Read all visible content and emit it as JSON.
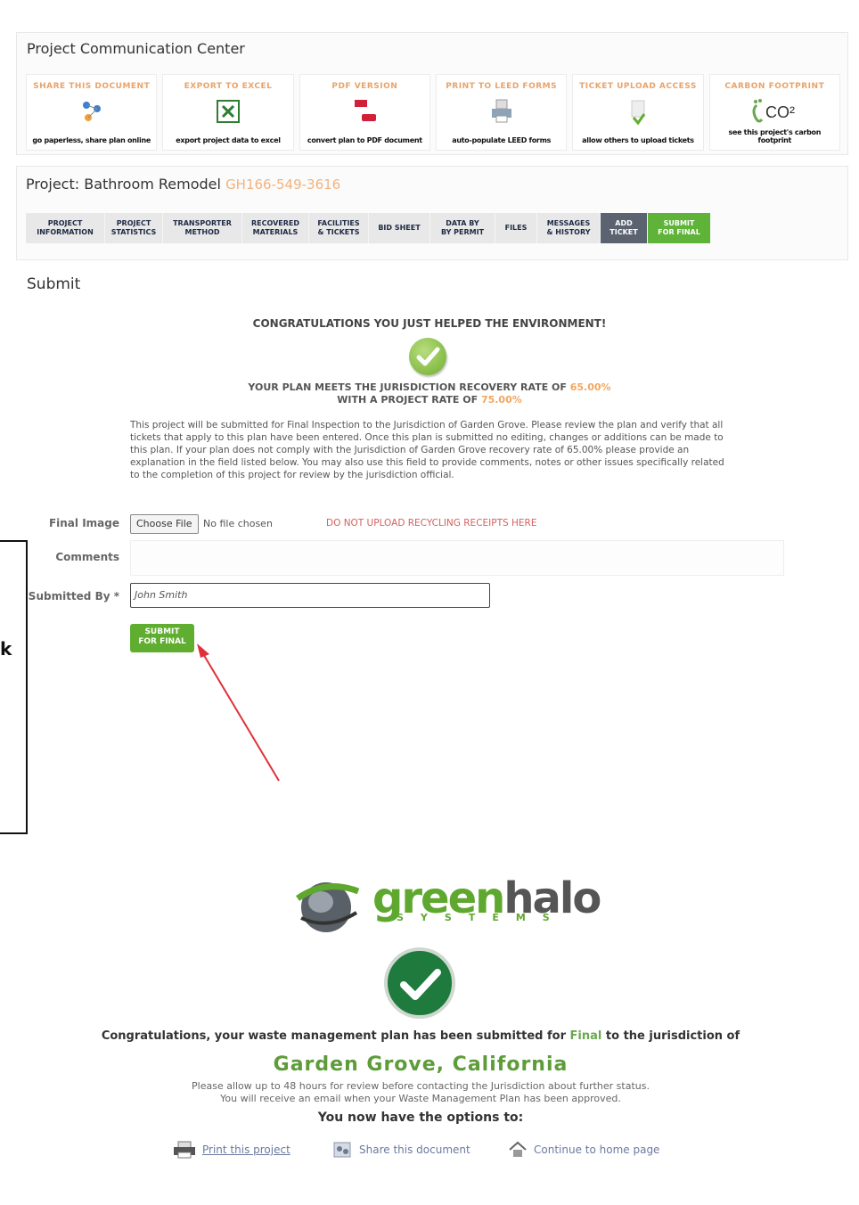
{
  "center": {
    "title": "Project Communication Center",
    "tools": [
      {
        "title": "SHARE THIS DOCUMENT",
        "desc": "go paperless, share plan online",
        "icon": "share-icon"
      },
      {
        "title": "EXPORT TO EXCEL",
        "desc": "export project data to excel",
        "icon": "excel-icon"
      },
      {
        "title": "PDF VERSION",
        "desc": "convert plan to PDF document",
        "icon": "pdf-icon"
      },
      {
        "title": "PRINT TO LEED FORMS",
        "desc": "auto-populate LEED forms",
        "icon": "print-icon"
      },
      {
        "title": "TICKET UPLOAD ACCESS",
        "desc": "allow others to upload tickets",
        "icon": "upload-icon"
      },
      {
        "title": "CARBON FOOTPRINT",
        "desc": "see this project's carbon footprint",
        "icon": "co2-icon"
      }
    ]
  },
  "project": {
    "label": "Project:",
    "name": "Bathroom Remodel",
    "id": "GH166-549-3616",
    "tabs": [
      {
        "line1": "PROJECT",
        "line2": "INFORMATION"
      },
      {
        "line1": "PROJECT",
        "line2": "STATISTICS"
      },
      {
        "line1": "TRANSPORTER",
        "line2": "METHOD"
      },
      {
        "line1": "RECOVERED",
        "line2": "MATERIALS"
      },
      {
        "line1": "FACILITIES",
        "line2": "& TICKETS"
      },
      {
        "line1": "BID SHEET",
        "line2": ""
      },
      {
        "line1": "DATA BY",
        "line2": "BY PERMIT"
      },
      {
        "line1": "FILES",
        "line2": ""
      },
      {
        "line1": "MESSAGES",
        "line2": "& HISTORY"
      },
      {
        "line1": "ADD",
        "line2": "TICKET"
      },
      {
        "line1": "SUBMIT",
        "line2": "FOR FINAL"
      }
    ]
  },
  "submit": {
    "heading": "Submit",
    "congrats": "CONGRATULATIONS YOU JUST HELPED THE ENVIRONMENT!",
    "rate_prefix": "YOUR PLAN MEETS THE JURISDICTION RECOVERY RATE OF",
    "rate_jurisdiction": "65.00%",
    "rate_mid": "WITH A PROJECT RATE OF",
    "rate_project": "75.00%",
    "body": "This project will be submitted for Final Inspection to the Jurisdiction of Garden Grove. Please review the plan and verify that all tickets that apply to this plan have been entered. Once this plan is submitted no editing, changes or additions can be made to this plan. If your plan does not comply with the Jurisdiction of Garden Grove recovery rate of 65.00% please provide an explanation in the field listed below. You may also use this field to provide comments, notes or other issues specifically related to the completion of this project for review by the jurisdiction official.",
    "final_image_label": "Final Image",
    "choose_file": "Choose File",
    "no_file": "No file chosen",
    "warning": "DO NOT UPLOAD RECYCLING RECEIPTS HERE",
    "comments_label": "Comments",
    "submitted_by_label": "Submitted By *",
    "submitted_by_value": "John Smith",
    "button_line1": "SUBMIT",
    "button_line2": "FOR FINAL",
    "side_letter": "k"
  },
  "confirmation": {
    "logo_green": "green",
    "logo_gray": "halo",
    "logo_sub": "SYSTEMS",
    "message_prefix": "Congratulations, your waste management plan has been submitted for",
    "message_final": "Final",
    "message_suffix": "to the jurisdiction of",
    "city": "Garden Grove, California",
    "note1": "Please allow up to 48 hours for review before contacting the Jurisdiction about further status.",
    "note2": "You will receive an email when your Waste Management Plan has been approved.",
    "options_heading": "You now have the options to:",
    "options": [
      {
        "label": "Print this project",
        "icon": "printer-icon"
      },
      {
        "label": "Share this document",
        "icon": "share-icon"
      },
      {
        "label": "Continue to home page",
        "icon": "home-icon"
      }
    ]
  },
  "colors": {
    "green": "#5fb339",
    "orange": "#f2b37d",
    "red_arrow": "#e0303a"
  }
}
